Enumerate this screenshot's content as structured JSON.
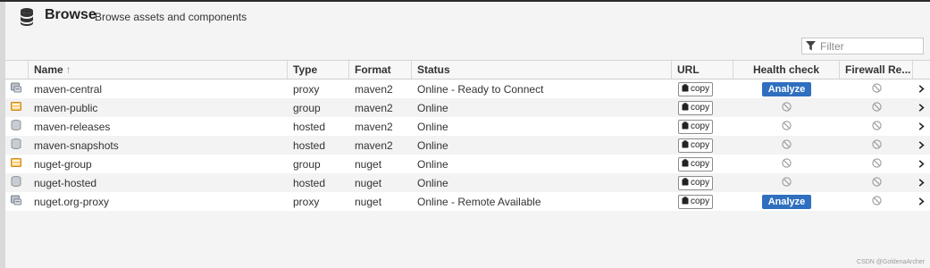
{
  "header": {
    "title": "Browse",
    "subtitle": "Browse assets and components"
  },
  "filter": {
    "placeholder": "Filter"
  },
  "columns": {
    "name": "Name",
    "sort_arrow": "↑",
    "type": "Type",
    "format": "Format",
    "status": "Status",
    "url": "URL",
    "health": "Health check",
    "firewall": "Firewall Re..."
  },
  "buttons": {
    "copy": "copy",
    "analyze": "Analyze"
  },
  "rows": [
    {
      "icon": "proxy-repo-icon",
      "name": "maven-central",
      "type": "proxy",
      "format": "maven2",
      "status": "Online - Ready to Connect",
      "health": "analyze"
    },
    {
      "icon": "group-repo-icon",
      "name": "maven-public",
      "type": "group",
      "format": "maven2",
      "status": "Online",
      "health": "disabled"
    },
    {
      "icon": "hosted-repo-icon",
      "name": "maven-releases",
      "type": "hosted",
      "format": "maven2",
      "status": "Online",
      "health": "disabled"
    },
    {
      "icon": "hosted-repo-icon",
      "name": "maven-snapshots",
      "type": "hosted",
      "format": "maven2",
      "status": "Online",
      "health": "disabled"
    },
    {
      "icon": "group-repo-icon",
      "name": "nuget-group",
      "type": "group",
      "format": "nuget",
      "status": "Online",
      "health": "disabled"
    },
    {
      "icon": "hosted-repo-icon",
      "name": "nuget-hosted",
      "type": "hosted",
      "format": "nuget",
      "status": "Online",
      "health": "disabled"
    },
    {
      "icon": "proxy-repo-icon",
      "name": "nuget.org-proxy",
      "type": "proxy",
      "format": "nuget",
      "status": "Online - Remote Available",
      "health": "analyze"
    }
  ],
  "watermark": "CSDN @GoldenaArcher",
  "colors": {
    "analyze": "#2f6fc0",
    "group_icon": "#e8a33a",
    "hosted_icon": "#9aa3ad"
  }
}
